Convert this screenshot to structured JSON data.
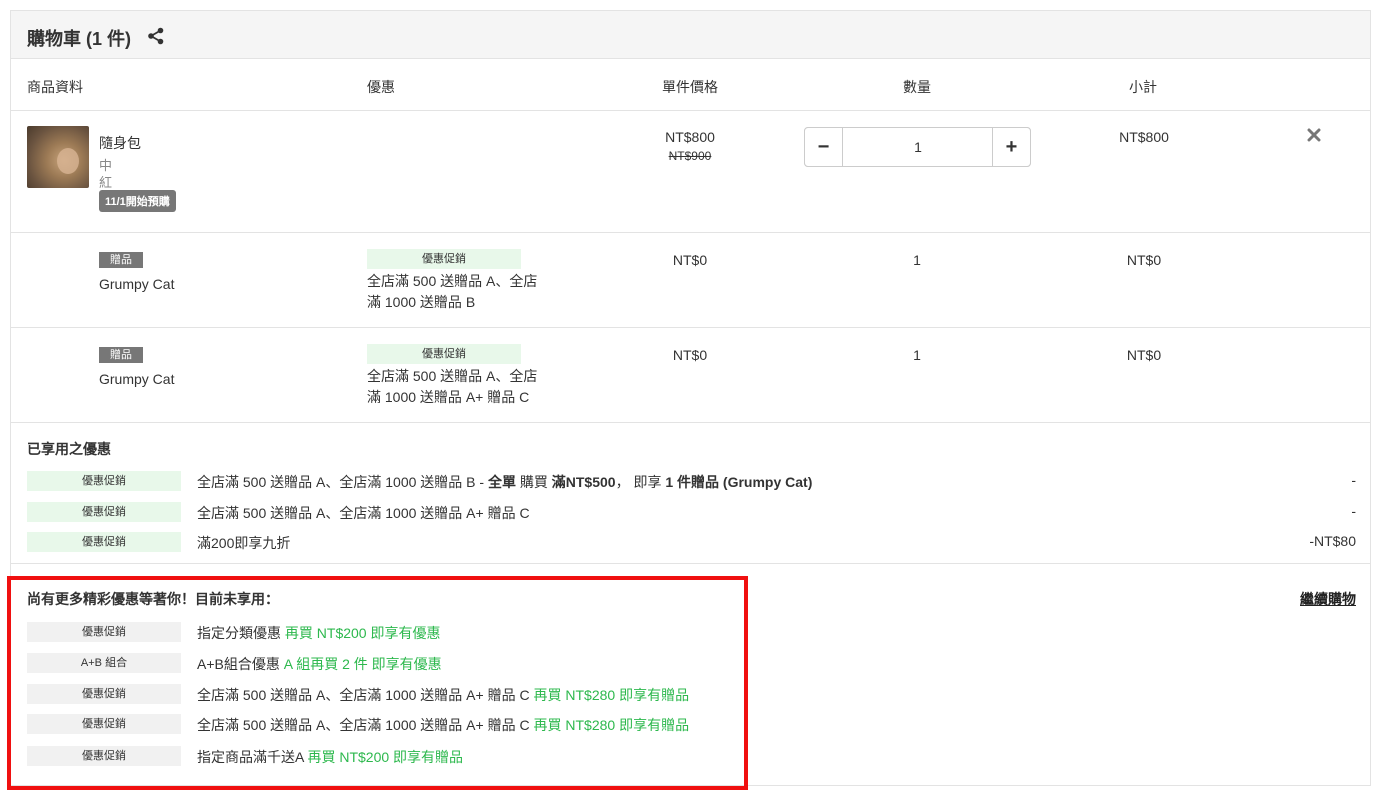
{
  "cart": {
    "title": "購物車 (1 件)",
    "share_icon": "share-icon"
  },
  "table_headers": {
    "product": "商品資料",
    "promotion": "優惠",
    "unit_price": "單件價格",
    "quantity": "數量",
    "subtotal": "小計"
  },
  "item": {
    "name": "隨身包",
    "size": "中",
    "color": "紅",
    "preorder_badge": "11/1開始預購",
    "price": "NT$800",
    "original_price": "NT$900",
    "quantity": "1",
    "subtotal": "NT$800",
    "minus_label": "−",
    "plus_label": "+",
    "remove_icon": "close-icon"
  },
  "gifts": [
    {
      "tag": "贈品",
      "name": "Grumpy Cat",
      "promo_tag": "優惠促銷",
      "promo_line1": "全店滿 500 送贈品 A、全店",
      "promo_line2": "滿 1000 送贈品 B",
      "price": "NT$0",
      "quantity": "1",
      "subtotal": "NT$0"
    },
    {
      "tag": "贈品",
      "name": "Grumpy Cat",
      "promo_tag": "優惠促銷",
      "promo_line1": "全店滿 500 送贈品 A、全店",
      "promo_line2": "滿 1000 送贈品 A+ 贈品 C",
      "price": "NT$0",
      "quantity": "1",
      "subtotal": "NT$0"
    }
  ],
  "applied": {
    "title": "已享用之優惠",
    "rows": [
      {
        "tag": "優惠促銷",
        "text": "全店滿 500 送贈品 A、全店滿 1000 送贈品 B - ",
        "bold1": "全單",
        "mid1": " 購買 ",
        "bold2": "滿NT$500",
        "mid2": "， 即享 ",
        "bold3": "1 件贈品 (Grumpy Cat)",
        "value": "-"
      },
      {
        "tag": "優惠促銷",
        "text": "全店滿 500 送贈品 A、全店滿 1000 送贈品 A+ 贈品 C",
        "value": "-"
      },
      {
        "tag": "優惠促銷",
        "text": "滿200即享九折",
        "value": "-NT$80"
      }
    ]
  },
  "unused": {
    "title": "尚有更多精彩優惠等著你！目前未享用：",
    "continue_shopping": "繼續購物",
    "rows": [
      {
        "tag": "優惠促銷",
        "text": "指定分類優惠 ",
        "hint": "再買 NT$200 即享有優惠"
      },
      {
        "tag": "A+B 組合",
        "text": "A+B組合優惠 ",
        "hint": "A 組再買 2 件 即享有優惠"
      },
      {
        "tag": "優惠促銷",
        "text": "全店滿 500 送贈品 A、全店滿 1000 送贈品 A+ 贈品 C ",
        "hint": "再買 NT$280 即享有贈品"
      },
      {
        "tag": "優惠促銷",
        "text": "全店滿 500 送贈品 A、全店滿 1000 送贈品 A+ 贈品 C ",
        "hint": "再買 NT$280 即享有贈品"
      },
      {
        "tag": "優惠促銷",
        "text": "指定商品滿千送A ",
        "hint": "再買 NT$200 即享有贈品"
      }
    ]
  },
  "colors": {
    "accent_green": "#2db84d",
    "highlight_red": "#f01010",
    "promo_green_bg": "#e8f8ea"
  }
}
